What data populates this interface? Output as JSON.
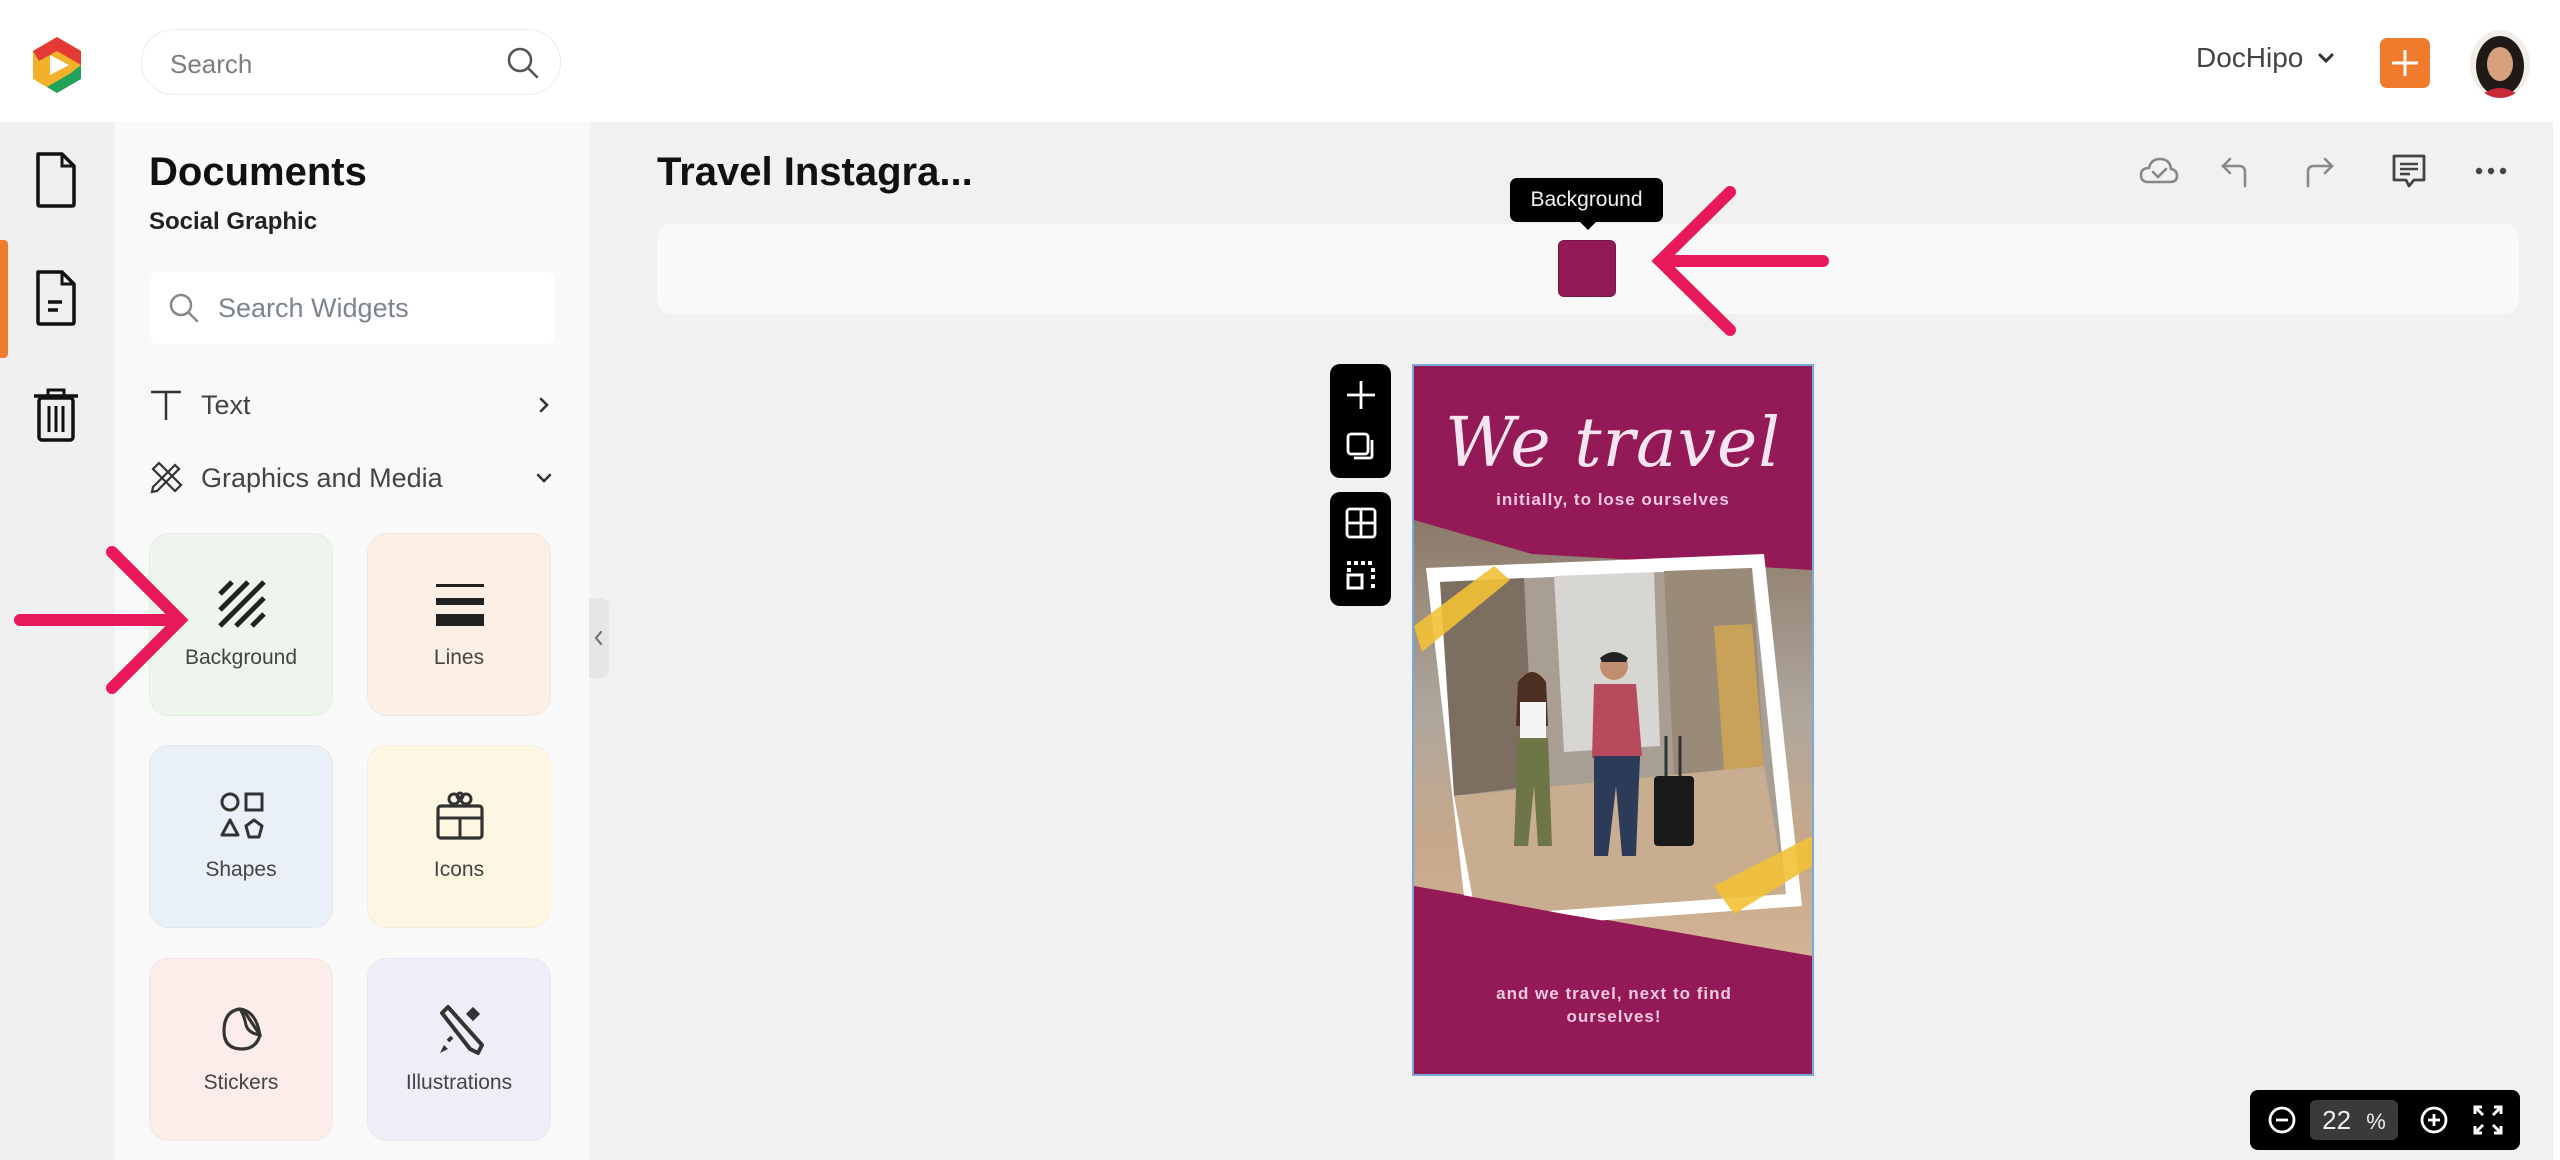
{
  "topbar": {
    "logo": "dochipo-logo",
    "search": {
      "placeholder": "Search",
      "icon": "search-icon"
    },
    "workspace": {
      "label": "DocHipo",
      "icon": "chevron-down-icon"
    },
    "add_button": {
      "icon": "plus-icon"
    },
    "avatar": "user-avatar"
  },
  "rail": {
    "items": [
      {
        "name": "documents",
        "icon": "document-icon",
        "active": false
      },
      {
        "name": "document-details",
        "icon": "document-text-icon",
        "active": true
      },
      {
        "name": "trash",
        "icon": "trash-icon",
        "active": false
      }
    ],
    "active_color": "#f07b2c"
  },
  "panel": {
    "title": "Documents",
    "subtitle": "Social Graphic",
    "search": {
      "placeholder": "Search Widgets"
    },
    "categories": [
      {
        "label": "Text",
        "icon": "text-icon",
        "state": "collapsed"
      },
      {
        "label": "Graphics and Media",
        "icon": "graphics-media-icon",
        "state": "expanded"
      }
    ],
    "widgets": [
      {
        "label": "Background",
        "icon": "background-pattern-icon",
        "color": "#edf5ec"
      },
      {
        "label": "Lines",
        "icon": "lines-icon",
        "color": "#fcefe6"
      },
      {
        "label": "Shapes",
        "icon": "shapes-icon",
        "color": "#e9f0f8"
      },
      {
        "label": "Icons",
        "icon": "gift-icon",
        "color": "#fdf6e3"
      },
      {
        "label": "Stickers",
        "icon": "sticker-icon",
        "color": "#fcecea"
      },
      {
        "label": "Illustrations",
        "icon": "illustration-icon",
        "color": "#eeeef8"
      }
    ]
  },
  "editor": {
    "doc_title": "Travel Instagra...",
    "header_actions": [
      {
        "name": "save-status",
        "icon": "cloud-check-icon"
      },
      {
        "name": "undo",
        "icon": "undo-icon"
      },
      {
        "name": "redo",
        "icon": "redo-icon"
      },
      {
        "name": "comments",
        "icon": "comment-icon"
      },
      {
        "name": "more",
        "icon": "more-horizontal-icon"
      }
    ],
    "context_bar": {
      "background_swatch_color": "#941a57",
      "tooltip": "Background"
    },
    "float_toolbar": [
      {
        "name": "add-page",
        "icon": "plus-icon"
      },
      {
        "name": "duplicate-page",
        "icon": "copy-icon"
      },
      {
        "name": "grid",
        "icon": "grid-icon"
      },
      {
        "name": "select-area",
        "icon": "select-area-icon"
      }
    ],
    "canvas": {
      "background_color": "#941a57",
      "title": "We travel",
      "subtitle": "initially, to lose ourselves",
      "footer": "and we travel, next to find ourselves!",
      "photo": "couple-walking-city-street-photo"
    },
    "zoom": {
      "value": "22",
      "unit": "%"
    }
  },
  "annotations": {
    "arrow_color": "#e8195a",
    "arrows": [
      "pointing-to-background-widget",
      "pointing-to-background-swatch"
    ]
  }
}
